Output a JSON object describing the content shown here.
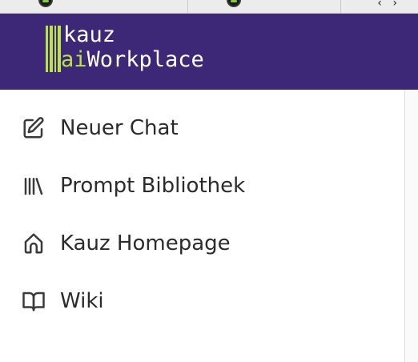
{
  "browser": {
    "tab_icon": "app-favicon-icon",
    "code_icon": "code-brackets-icon",
    "code_glyph": "‹ ›"
  },
  "header": {
    "background_color": "#3d2777",
    "logo": {
      "line1": "kauz",
      "line2_accent": "ai",
      "line2_rest": "Workplace",
      "accent_color": "#b8e34a"
    }
  },
  "sidebar": {
    "items": [
      {
        "label": "Neuer Chat",
        "icon": "edit-icon"
      },
      {
        "label": "Prompt Bibliothek",
        "icon": "library-icon"
      },
      {
        "label": "Kauz Homepage",
        "icon": "home-icon"
      },
      {
        "label": "Wiki",
        "icon": "book-open-icon"
      }
    ]
  }
}
